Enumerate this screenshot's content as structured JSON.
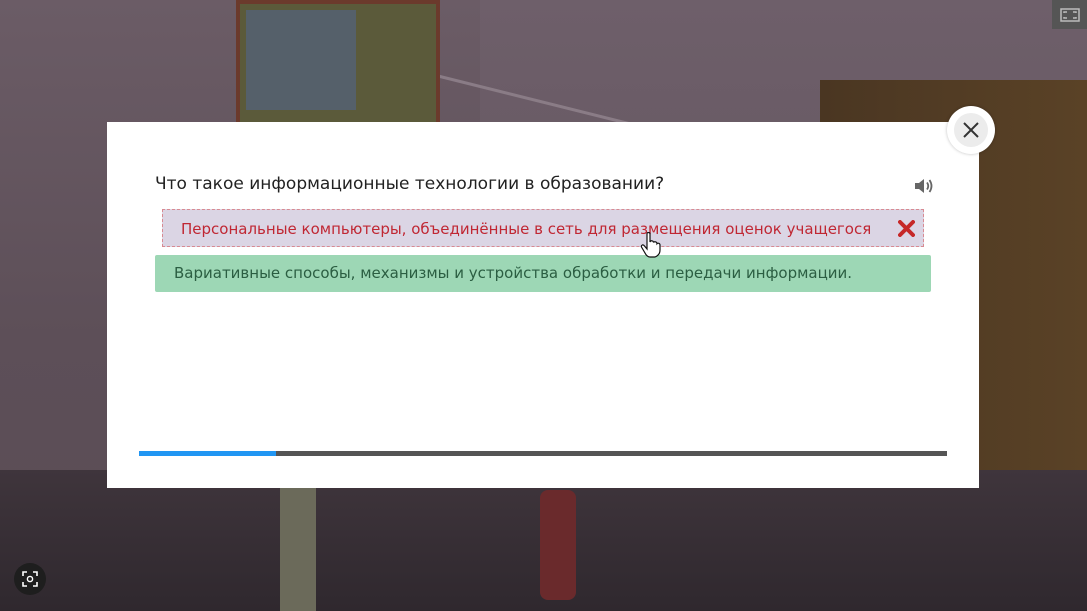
{
  "quiz": {
    "question": "Что такое информационные технологии в образовании?",
    "answers": [
      {
        "text": "Персональные компьютеры, объединённые в сеть для размещения оценок учащегося",
        "state": "wrong",
        "icon": "x-icon"
      },
      {
        "text": "Вариативные способы, механизмы и устройства обработки и передачи информации.",
        "state": "correct"
      }
    ],
    "progress_fraction": 0.17
  },
  "icons": {
    "close": "close-icon",
    "sound": "speaker-icon",
    "fullscreen": "fullscreen-icon",
    "capture": "screenshot-icon"
  },
  "colors": {
    "wrong_bg": "#dbd5e4",
    "wrong_text": "#c02733",
    "correct_bg": "#9dd7b5",
    "correct_text": "#2b5e42",
    "progress_fill": "#2196f3",
    "progress_track": "#555555"
  }
}
